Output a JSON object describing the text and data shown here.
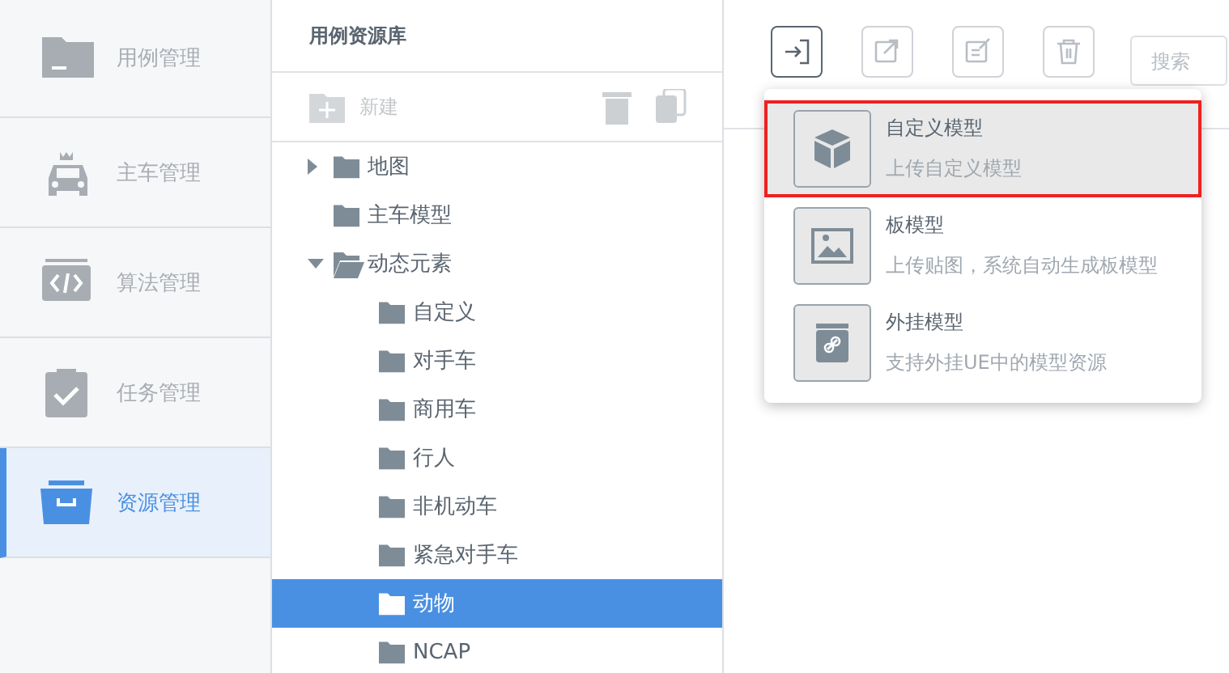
{
  "sidebar": {
    "items": [
      {
        "label": "用例管理",
        "selected": false
      },
      {
        "label": "主车管理",
        "selected": false
      },
      {
        "label": "算法管理",
        "selected": false
      },
      {
        "label": "任务管理",
        "selected": false
      },
      {
        "label": "资源管理",
        "selected": true
      }
    ]
  },
  "library": {
    "title": "用例资源库",
    "new_button": "新建",
    "tree": [
      {
        "label": "地图",
        "expanded": false,
        "selected": false
      },
      {
        "label": "主车模型",
        "selected": false
      },
      {
        "label": "动态元素",
        "expanded": true,
        "selected": false,
        "children": [
          {
            "label": "自定义",
            "selected": false
          },
          {
            "label": "对手车",
            "selected": false
          },
          {
            "label": "商用车",
            "selected": false
          },
          {
            "label": "行人",
            "selected": false
          },
          {
            "label": "非机动车",
            "selected": false
          },
          {
            "label": "紧急对手车",
            "selected": false
          },
          {
            "label": "动物",
            "selected": true
          },
          {
            "label": "NCAP",
            "selected": false
          }
        ]
      }
    ]
  },
  "toolbar": {
    "buttons": [
      {
        "active": true
      },
      {
        "active": false
      },
      {
        "active": false
      },
      {
        "active": false
      }
    ],
    "search": {
      "placeholder": "搜索"
    }
  },
  "upload_menu": {
    "items": [
      {
        "title": "自定义模型",
        "description": "上传自定义模型",
        "selected": true
      },
      {
        "title": "板模型",
        "description": "上传贴图，系统自动生成板模型",
        "selected": false
      },
      {
        "title": "外挂模型",
        "description": "支持外挂UE中的模型资源",
        "selected": false
      }
    ]
  }
}
